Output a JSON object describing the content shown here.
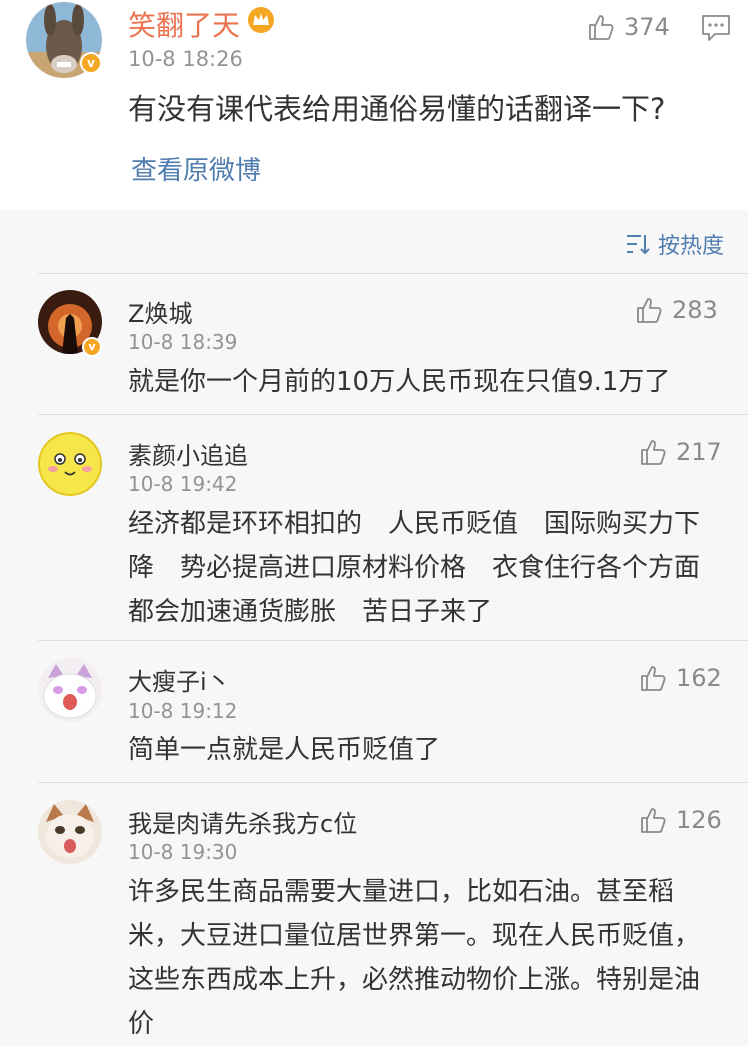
{
  "original_post": {
    "user_name": "笑翻了天",
    "time": "10-8 18:26",
    "text": "有没有课代表给用通俗易懂的话翻译一下?",
    "likes": "374",
    "view_original": "查看原微博"
  },
  "sort_label": "按热度",
  "comments": [
    {
      "user_name": "Z焕城",
      "time": "10-8 18:39",
      "likes": "283",
      "text": "就是你一个月前的10万人民币现在只值9.1万了"
    },
    {
      "user_name": "素颜小追追",
      "time": "10-8 19:42",
      "likes": "217",
      "text": "经济都是环环相扣的　人民币贬值　国际购买力下降　势必提高进口原材料价格　衣食住行各个方面　都会加速通货膨胀　苦日子来了"
    },
    {
      "user_name": "大瘦子i丶",
      "time": "10-8 19:12",
      "likes": "162",
      "text": "简单一点就是人民币贬值了"
    },
    {
      "user_name": "我是肉请先杀我方c位",
      "time": "10-8 19:30",
      "likes": "126",
      "text": "许多民生商品需要大量进口，比如石油。甚至稻米，大豆进口量位居世界第一。现在人民币贬值，这些东西成本上升，必然推动物价上涨。特别是油价"
    }
  ],
  "colors": {
    "name_accent": "#eb7350",
    "link": "#507daf",
    "verified": "#f5a623"
  }
}
